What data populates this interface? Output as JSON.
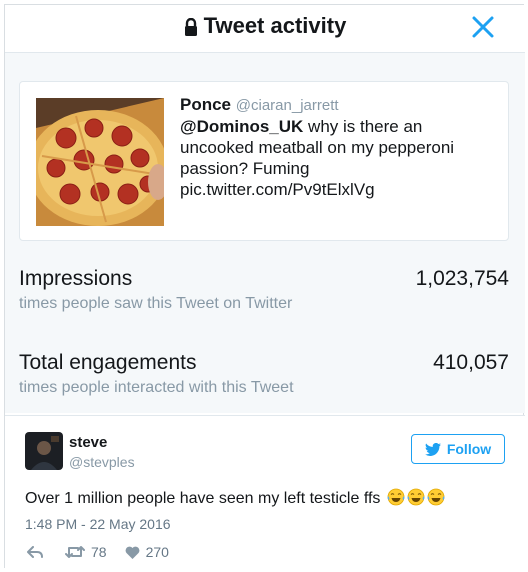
{
  "modal": {
    "title": "Tweet activity",
    "close_icon": "close-icon",
    "lock_icon": "lock-icon"
  },
  "tweet": {
    "author_name": "Ponce",
    "author_handle": "@ciaran_jarrett",
    "mention": "@Dominos_UK",
    "text": " why is there an uncooked meatball on my pepperoni passion? Fuming",
    "link": "pic.twitter.com/Pv9tElxlVg"
  },
  "metrics": {
    "impressions": {
      "label": "Impressions",
      "sub": "times people saw this Tweet on Twitter",
      "value": "1,023,754"
    },
    "engagements": {
      "label": "Total engagements",
      "sub": "times people interacted with this Tweet",
      "value": "410,057"
    }
  },
  "reply": {
    "name": "steve",
    "handle": "@stevples",
    "follow_label": "Follow",
    "text": "Over 1 million people have seen my left testicle ffs",
    "timestamp": "1:48 PM - 22 May 2016",
    "retweets": "78",
    "likes": "270"
  },
  "colors": {
    "accent": "#1da1f2",
    "muted": "#8899a6",
    "background": "#f5f8fa"
  }
}
